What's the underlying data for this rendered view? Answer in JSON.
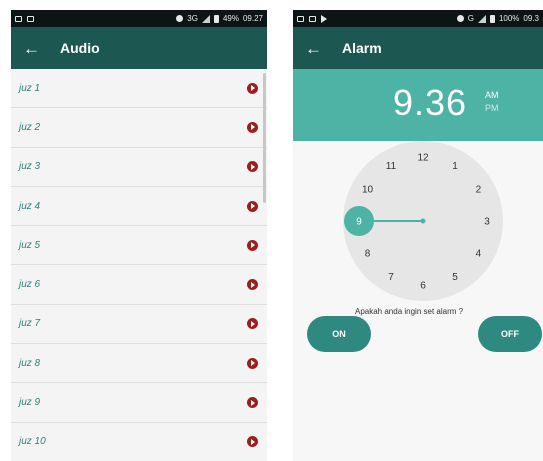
{
  "screens": {
    "audio": {
      "status_bar": {
        "network": "3G",
        "battery": "49%",
        "time": "09.27"
      },
      "title": "Audio",
      "items": [
        "juz 1",
        "juz 2",
        "juz 3",
        "juz 4",
        "juz 5",
        "juz 6",
        "juz 7",
        "juz 8",
        "juz 9",
        "juz 10"
      ]
    },
    "alarm": {
      "status_bar": {
        "network": "G",
        "battery": "100%",
        "time": "09.3"
      },
      "title": "Alarm",
      "time": "9.36",
      "am": "AM",
      "pm": "PM",
      "clock_numbers": [
        "12",
        "1",
        "2",
        "3",
        "4",
        "5",
        "6",
        "7",
        "8",
        "9",
        "10",
        "11"
      ],
      "selected_hour": "9",
      "prompt": "Apakah anda ingin set alarm ?",
      "on_label": "ON",
      "off_label": "OFF"
    }
  },
  "colors": {
    "appbar": "#1d5752",
    "accent": "#4cb3a5",
    "button": "#2e8a80",
    "play": "#9b1f1f"
  }
}
